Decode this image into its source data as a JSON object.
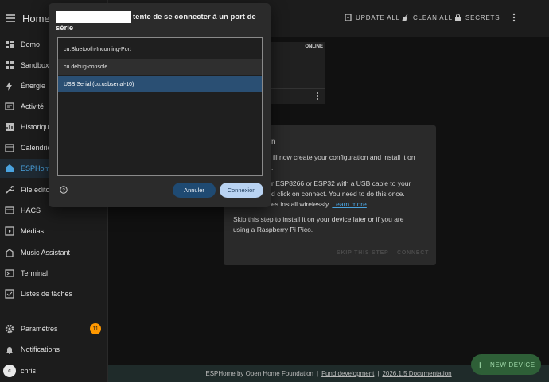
{
  "app": {
    "title": "Home A"
  },
  "topbar": {
    "update_all": "UPDATE ALL",
    "clean_all": "CLEAN ALL",
    "secrets": "SECRETS"
  },
  "sidebar": {
    "items": [
      {
        "label": "Domo",
        "icon": "dashboard-icon"
      },
      {
        "label": "Sandbox",
        "icon": "grid-icon"
      },
      {
        "label": "Énergie",
        "icon": "lightning-icon"
      },
      {
        "label": "Activité",
        "icon": "activity-icon"
      },
      {
        "label": "Historique",
        "icon": "chart-icon"
      },
      {
        "label": "Calendrier",
        "icon": "calendar-icon"
      },
      {
        "label": "ESPHome",
        "icon": "esphome-icon"
      },
      {
        "label": "File editor",
        "icon": "wrench-icon"
      },
      {
        "label": "HACS",
        "icon": "hacs-icon"
      },
      {
        "label": "Médias",
        "icon": "media-icon"
      },
      {
        "label": "Music Assistant",
        "icon": "music-icon"
      },
      {
        "label": "Terminal",
        "icon": "terminal-icon"
      },
      {
        "label": "Listes de tâches",
        "icon": "checklist-icon"
      }
    ],
    "settings_label": "Paramètres",
    "settings_badge": "11",
    "notifications_label": "Notifications",
    "user_initial": "c",
    "user_name": "chris",
    "active_color": "#4aa3df",
    "badge_color": "#ff9800"
  },
  "device_card": {
    "status": "ONLINE"
  },
  "install_panel": {
    "heading_fragment": "n",
    "p1_lines": [
      "ill now create your configuration and install it on",
      "."
    ],
    "p2_lines": [
      "r ESP8266 or ESP32 with a USB cable to your",
      "d click on connect. You need to do this once.",
      "es install wirelessly."
    ],
    "learn_more": "Learn more",
    "p3_lines": [
      "Skip this step to install it on your device later or if you are",
      "using a Raspberry Pi Pico."
    ],
    "skip_label": "SKIP THIS STEP",
    "connect_label": "CONNECT"
  },
  "dialog": {
    "title_line1": "tente de se connecter à un port de",
    "title_line2": "série",
    "ports": [
      "cu.Bluetooth-Incoming-Port",
      "cu.debug-console",
      "USB Serial (cu.usbserial-10)"
    ],
    "selected_port": "USB Serial (cu.usbserial-10)",
    "cancel_label": "Annuler",
    "connect_label": "Connexion"
  },
  "footer": {
    "text": "ESPHome by Open Home Foundation",
    "fund": "Fund development",
    "version": "2026.1.5 Documentation"
  },
  "fab": {
    "label": "NEW DEVICE"
  }
}
